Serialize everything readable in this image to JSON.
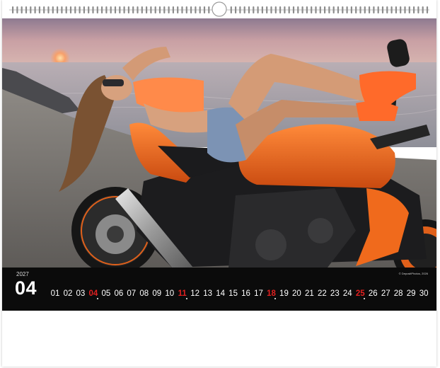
{
  "calendar": {
    "year": "2027",
    "month_number": "04",
    "copyright": "© DepositPhotos, 2026",
    "days": [
      "01",
      "02",
      "03",
      "04",
      "05",
      "06",
      "07",
      "08",
      "09",
      "10",
      "11",
      "12",
      "13",
      "14",
      "15",
      "16",
      "17",
      "18",
      "19",
      "20",
      "21",
      "22",
      "23",
      "24",
      "25",
      "26",
      "27",
      "28",
      "29",
      "30"
    ],
    "holidays": [
      "04",
      "11",
      "18",
      "25"
    ],
    "accent_color": "#e02020",
    "strip_color": "#0b0b0b"
  },
  "photo": {
    "subject": "motorcycle-with-model",
    "bike_color": "#f06a1c"
  }
}
